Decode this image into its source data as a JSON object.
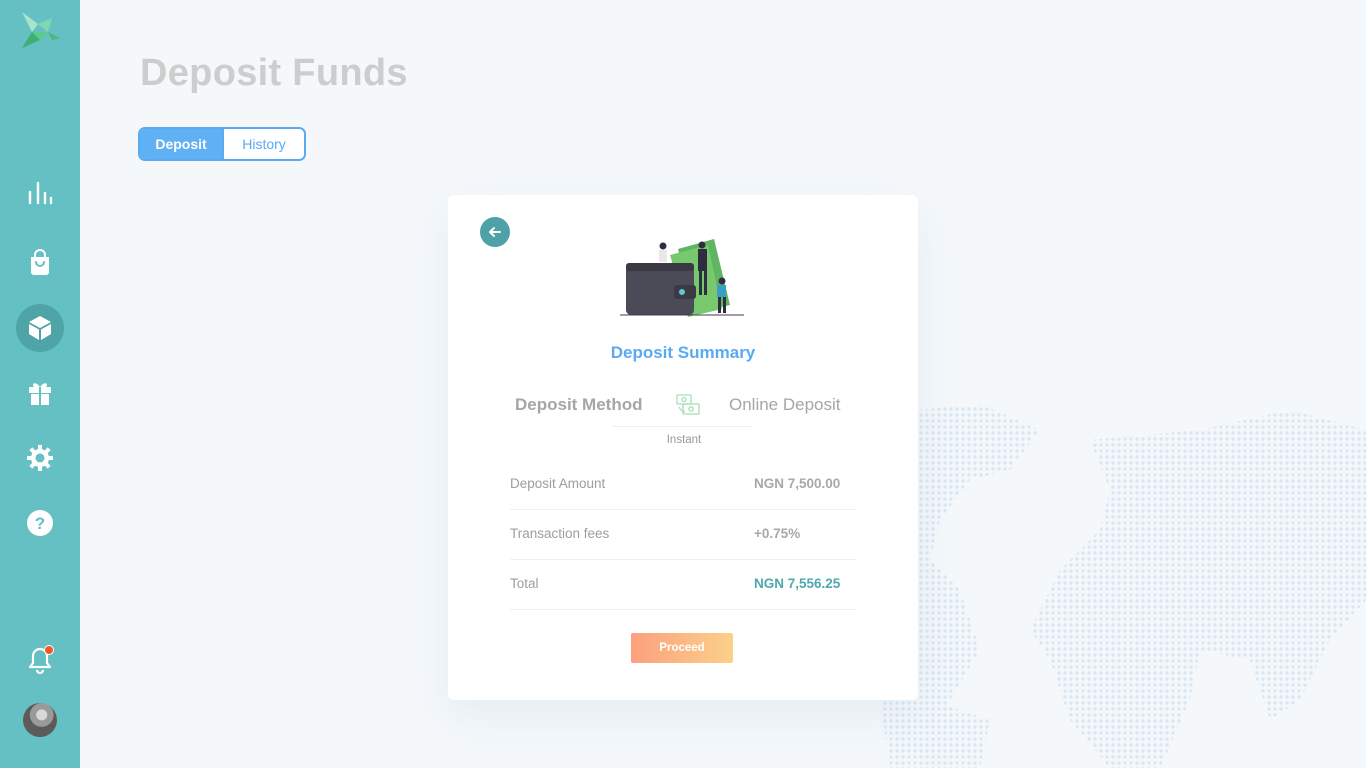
{
  "page": {
    "title": "Deposit Funds"
  },
  "tabs": [
    {
      "label": "Deposit",
      "active": true
    },
    {
      "label": "History",
      "active": false
    }
  ],
  "sidebar": {
    "items": [
      {
        "icon": "bar-chart-icon"
      },
      {
        "icon": "shopping-bag-icon"
      },
      {
        "icon": "cube-icon",
        "active": true
      },
      {
        "icon": "gift-icon"
      },
      {
        "icon": "gear-icon"
      },
      {
        "icon": "help-icon"
      }
    ],
    "notification": {
      "icon": "bell-icon",
      "has_unread": true
    },
    "avatar": {
      "icon": "user-avatar"
    }
  },
  "summary": {
    "title": "Deposit Summary",
    "method": {
      "label": "Deposit Method",
      "value": "Online Deposit",
      "speed": "Instant",
      "icon": "cash-transfer-icon"
    },
    "rows": [
      {
        "label": "Deposit Amount",
        "value": "NGN 7,500.00"
      },
      {
        "label": "Transaction fees",
        "value": "+0.75%"
      },
      {
        "label": "Total",
        "value": "NGN 7,556.25"
      }
    ],
    "proceed_label": "Proceed"
  },
  "colors": {
    "sidebar": "#65c0c3",
    "sidebar_active": "#4fa4a8",
    "accent_blue": "#5aaaf2",
    "total_teal": "#4ea9ad",
    "proceed_start": "#fda07d",
    "proceed_end": "#fbd08a",
    "notification_dot": "#f15a29"
  }
}
